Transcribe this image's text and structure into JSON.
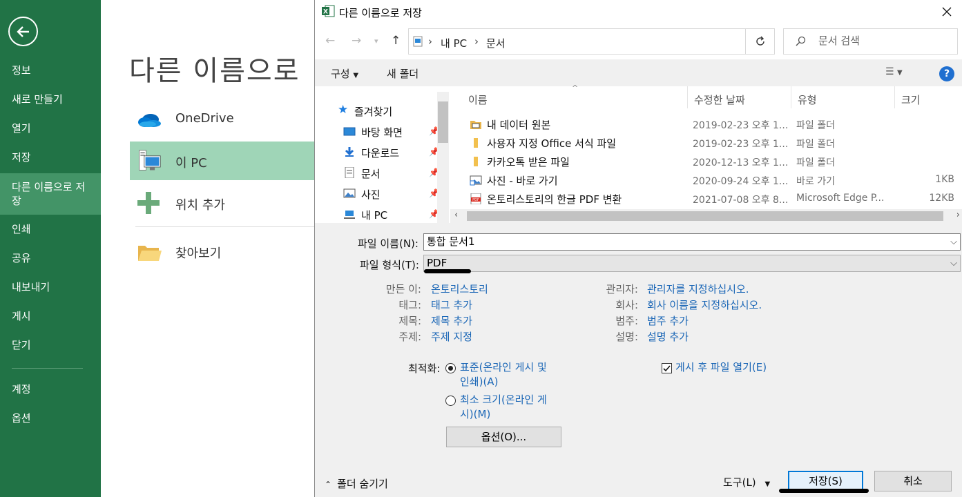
{
  "backstage": {
    "nav": [
      {
        "label": "정보"
      },
      {
        "label": "새로 만들기"
      },
      {
        "label": "열기"
      },
      {
        "label": "저장"
      },
      {
        "label": "다른 이름으로 저장",
        "line1": "다른 이름으로 저",
        "line2": "장"
      },
      {
        "label": "인쇄"
      },
      {
        "label": "공유"
      },
      {
        "label": "내보내기"
      },
      {
        "label": "게시"
      },
      {
        "label": "닫기"
      },
      {
        "label": "계정"
      },
      {
        "label": "옵션"
      }
    ],
    "title": "다른 이름으로",
    "locations": [
      {
        "label": "OneDrive",
        "icon": "onedrive-icon"
      },
      {
        "label": "이 PC",
        "icon": "pc-icon"
      },
      {
        "label": "위치 추가",
        "icon": "plus-icon"
      },
      {
        "label": "찾아보기",
        "icon": "folder-icon"
      }
    ],
    "colors": {
      "green": "#217346",
      "active": "#439467",
      "selected_location": "#9fd5b7"
    }
  },
  "dialog": {
    "title": "다른 이름으로 저장",
    "breadcrumb": [
      "내 PC",
      "문서"
    ],
    "search_placeholder": "문서 검색",
    "commands": {
      "organize": "구성",
      "new_folder": "새 폴더"
    },
    "help": "?",
    "tree": [
      {
        "label": "즐겨찾기",
        "icon": "star-icon"
      },
      {
        "label": "바탕 화면",
        "icon": "desktop-icon",
        "pinned": true
      },
      {
        "label": "다운로드",
        "icon": "download-icon",
        "pinned": true
      },
      {
        "label": "문서",
        "icon": "document-icon",
        "pinned": true
      },
      {
        "label": "사진",
        "icon": "pictures-icon",
        "pinned": true
      },
      {
        "label": "내 PC",
        "icon": "computer-icon",
        "pinned": true
      }
    ],
    "columns": {
      "name": "이름",
      "date": "수정한 날짜",
      "type": "유형",
      "size": "크기"
    },
    "files": [
      {
        "name": "내 데이터 원본",
        "date": "2019-02-23 오후 1...",
        "type": "파일 폴더",
        "size": "",
        "icon": "data-folder-icon"
      },
      {
        "name": "사용자 지정 Office 서식 파일",
        "date": "2019-02-23 오후 1...",
        "type": "파일 폴더",
        "size": "",
        "icon": "folder-icon"
      },
      {
        "name": "카카오톡 받은 파일",
        "date": "2020-12-13 오후 1...",
        "type": "파일 폴더",
        "size": "",
        "icon": "folder-icon"
      },
      {
        "name": "사진 - 바로 가기",
        "date": "2020-09-24 오후 1...",
        "type": "바로 가기",
        "size": "1KB",
        "icon": "shortcut-icon"
      },
      {
        "name": "온토리스토리의 한글 PDF 변환",
        "date": "2021-07-08 오후 8...",
        "type": "Microsoft Edge P...",
        "size": "12KB",
        "icon": "pdf-icon"
      }
    ],
    "form": {
      "filename_label": "파일 이름(N):",
      "filename_value": "통합 문서1",
      "filetype_label": "파일 형식(T):",
      "filetype_value": "PDF"
    },
    "meta": {
      "author_label": "만든 이:",
      "author_value": "온토리스토리",
      "tags_label": "태그:",
      "tags_value": "태그 추가",
      "title_label": "제목:",
      "title_value": "제목 추가",
      "subject_label": "주제:",
      "subject_value": "주제 지정",
      "manager_label": "관리자:",
      "manager_value": "관리자를 지정하십시오.",
      "company_label": "회사:",
      "company_value": "회사 이름을 지정하십시오.",
      "category_label": "범주:",
      "category_value": "범주 추가",
      "comments_label": "설명:",
      "comments_value": "설명 추가"
    },
    "optimize": {
      "label": "최적화:",
      "standard_line1": "표준(온라인 게시 및",
      "standard_line2": "인쇄)(A)",
      "minimum_line1": "최소 크기(온라인 게",
      "minimum_line2": "시)(M)",
      "selected": "standard"
    },
    "open_after": {
      "label": "게시 후 파일 열기(E)",
      "checked": true
    },
    "options_button": "옵션(O)...",
    "hide_folders": "폴더 숨기기",
    "tools": "도구(L)",
    "save": "저장(S)",
    "cancel": "취소"
  }
}
